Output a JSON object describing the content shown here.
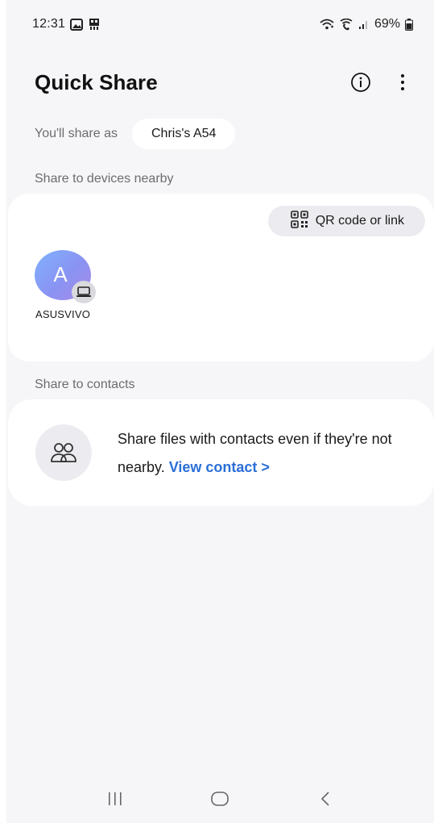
{
  "status_bar": {
    "time": "12:31",
    "battery": "69%",
    "icons": [
      "gallery-icon",
      "screen-cast-icon",
      "wifi-icon",
      "wifi-calling-icon",
      "signal-icon",
      "battery-icon"
    ]
  },
  "header": {
    "title": "Quick Share",
    "icons": [
      "info-icon",
      "more-options-icon"
    ]
  },
  "share_as": {
    "label": "You'll share as",
    "device_name": "Chris's A54"
  },
  "nearby": {
    "section_label": "Share to devices nearby",
    "qr_button_label": "QR code or link",
    "devices": [
      {
        "initial": "A",
        "name": "ASUSVIVO",
        "type_icon": "laptop-icon"
      }
    ]
  },
  "contacts": {
    "section_label": "Share to contacts",
    "description": "Share files with contacts even if they're not nearby.",
    "link_label": "View contact >"
  },
  "nav_bar": {
    "icons": [
      "recents-icon",
      "home-icon",
      "back-icon"
    ]
  },
  "colors": {
    "background": "#f6f6f8",
    "card": "#ffffff",
    "link": "#2a6fd6",
    "secondary_text": "#6c6c70"
  }
}
